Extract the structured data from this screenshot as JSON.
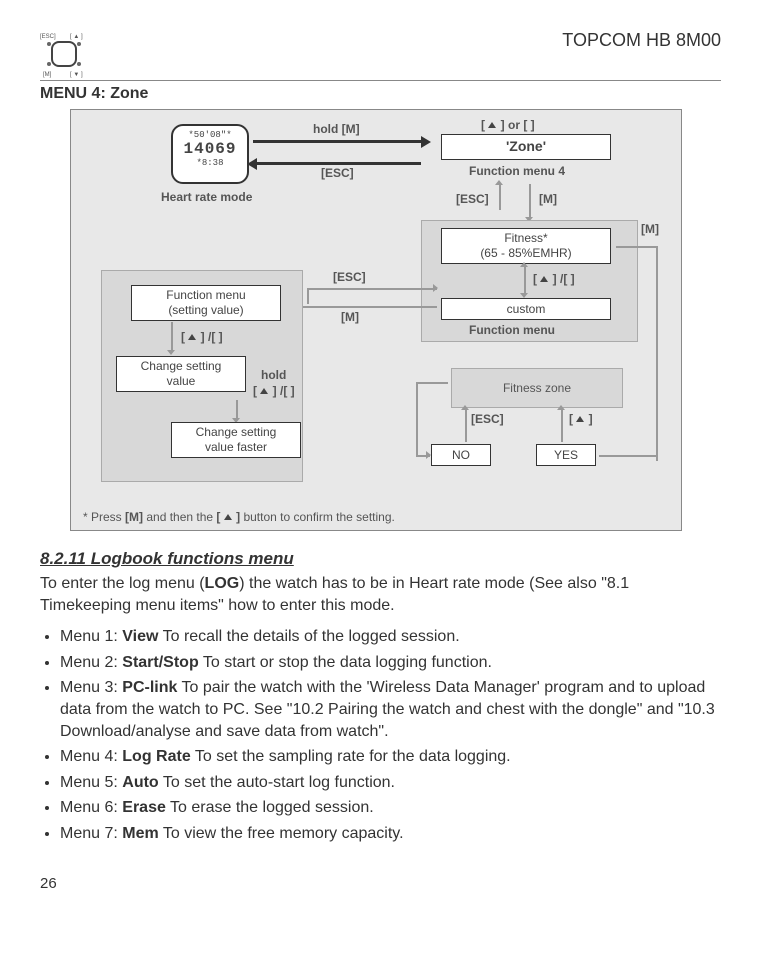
{
  "header": {
    "product": "TOPCOM HB 8M00"
  },
  "watch_labels": {
    "esc": "[ESC]",
    "up": "[   ]",
    "m": "[M]",
    "down": "[   ]"
  },
  "menu4": {
    "title": "MENU 4: Zone",
    "device": {
      "l1": "*50'08\"*",
      "l2": "14069",
      "l3": "*8:38"
    },
    "heart_rate_caption": "Heart rate mode",
    "hold_m": "hold [M]",
    "esc": "[ESC]",
    "updown_or": "[    ] or [    ]",
    "zone_title": "'Zone'",
    "func_menu4": "Function menu 4",
    "m": "[M]",
    "fitness": {
      "l1": "Fitness*",
      "l2": "(65 - 85%EMHR)"
    },
    "updown_slash": "[    ] /[    ]",
    "custom": "custom",
    "func_menu": "Function menu",
    "fm_setting": {
      "l1": "Function menu",
      "l2": "(setting value)"
    },
    "change_setting": {
      "l1": "Change setting",
      "l2": "value"
    },
    "change_setting_fast": {
      "l1": "Change setting",
      "l2": "value faster"
    },
    "hold": "hold",
    "fitness_zone": "Fitness zone",
    "no": "NO",
    "yes": "YES",
    "up_only": "[    ]",
    "footnote_pre": "* Press ",
    "footnote_m": "[M]",
    "footnote_mid": " and then the ",
    "footnote_btn": "[    ]",
    "footnote_post": " button to confirm the setting."
  },
  "logbook": {
    "heading": "8.2.11 Logbook functions menu",
    "intro_pre": "To enter the log menu (",
    "intro_bold": "LOG",
    "intro_post": ") the watch has to be in Heart rate mode (See also \"8.1 Timekeeping menu items\" how to enter this mode.",
    "items": [
      {
        "prefix": "Menu 1: ",
        "bold": "View",
        "rest": " To recall the details of the logged session."
      },
      {
        "prefix": "Menu 2: ",
        "bold": "Start/Stop",
        "rest": " To start or stop the data logging function."
      },
      {
        "prefix": "Menu 3: ",
        "bold": "PC-link",
        "rest": " To pair the watch with the 'Wireless Data Manager' program and to upload data from the watch to PC. See \"10.2 Pairing the watch and chest with the dongle\" and \"10.3 Download/analyse and save data from watch\"."
      },
      {
        "prefix": "Menu 4: ",
        "bold": "Log Rate",
        "rest": " To set the sampling rate for the data logging."
      },
      {
        "prefix": "Menu 5: ",
        "bold": "Auto",
        "rest": " To set the auto-start log function."
      },
      {
        "prefix": "Menu 6: ",
        "bold": "Erase",
        "rest": " To erase the logged session."
      },
      {
        "prefix": "Menu 7: ",
        "bold": "Mem",
        "rest": " To view the free memory capacity."
      }
    ]
  },
  "page": "26"
}
